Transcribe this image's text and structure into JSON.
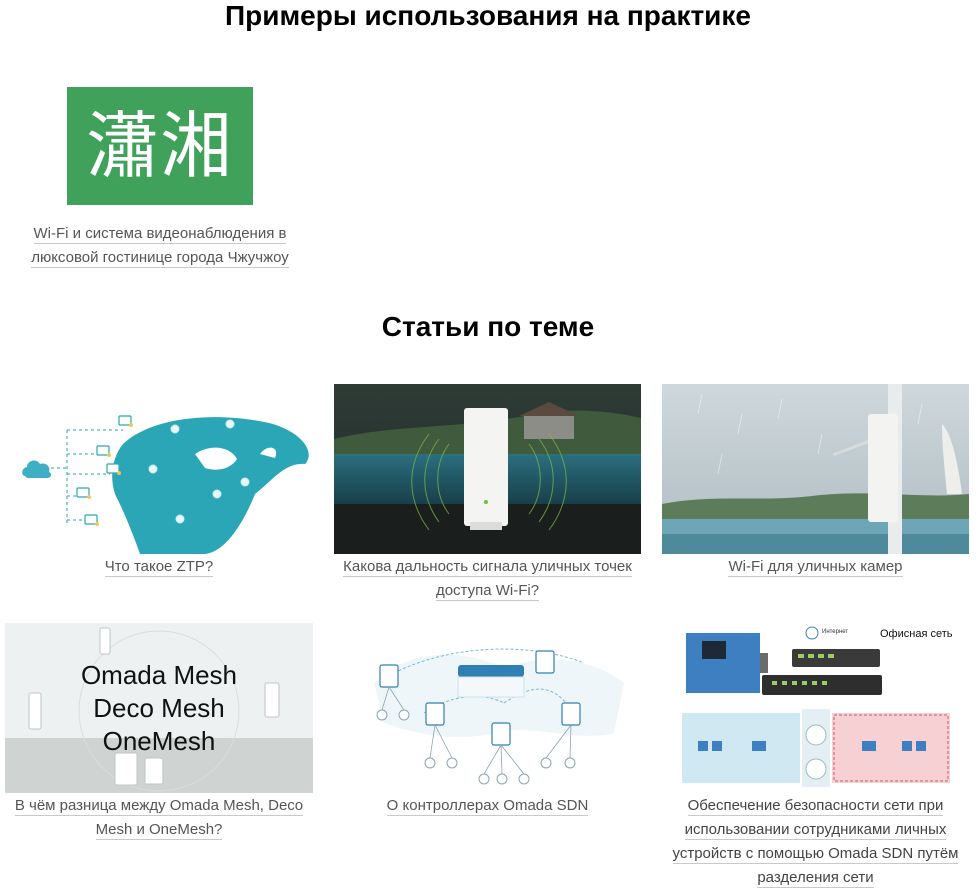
{
  "sections": {
    "cases_title": "Примеры использования на практике",
    "articles_title": "Статьи по теме"
  },
  "cases": [
    {
      "logo_text": "瀟湘",
      "caption_line1": "Wi-Fi и система видеонаблюдения в",
      "caption_line2": "люксовой гостинице города Чжучжоу"
    }
  ],
  "articles": [
    {
      "caption_line1": "Что такое ZTP?",
      "caption_line2": ""
    },
    {
      "caption_line1": "Какова дальность сигнала уличных точек",
      "caption_line2": "доступа Wi-Fi?"
    },
    {
      "caption_line1": "Wi-Fi для уличных камер",
      "caption_line2": ""
    },
    {
      "caption_line1": "В чём разница между Omada Mesh, Deco",
      "caption_line2": "Mesh и OneMesh?",
      "overlay": [
        "Omada Mesh",
        "Deco Mesh",
        "OneMesh"
      ]
    },
    {
      "caption_line1": "О контроллерах Omada SDN",
      "caption_line2": ""
    },
    {
      "caption_line1": "Обеспечение безопасности сети при",
      "caption_line2": "использовании сотрудниками личных",
      "caption_line3": "устройств с помощью Omada SDN путём",
      "caption_line4": "разделения сети",
      "diagram_title": "Офисная сеть",
      "diagram_internet": "Интернет"
    }
  ],
  "colors": {
    "logo_green": "#3fa15a",
    "map_teal": "#2aa6b7",
    "link_gray": "#555555",
    "underline": "#c9c9c9"
  }
}
